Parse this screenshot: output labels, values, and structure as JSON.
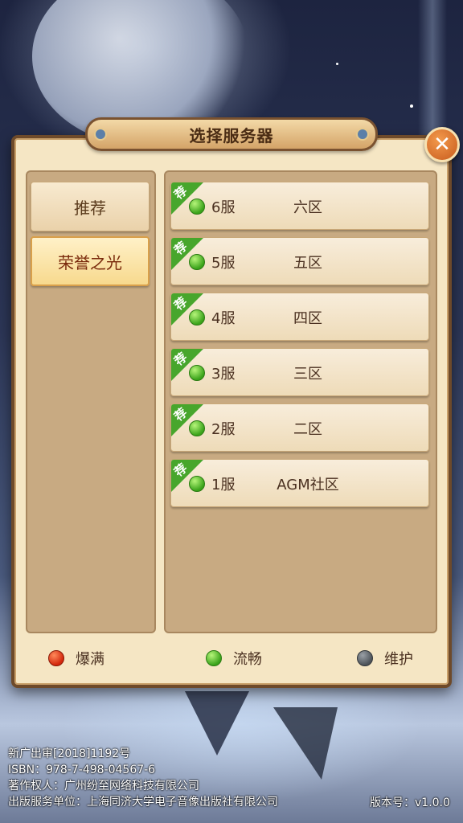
{
  "dialog": {
    "title": "选择服务器",
    "close_label": "✕"
  },
  "categories": [
    {
      "label": "推荐",
      "active": false
    },
    {
      "label": "荣誉之光",
      "active": true
    }
  ],
  "servers": [
    {
      "tag": "荐",
      "name": "6服",
      "area": "六区",
      "status": "流畅"
    },
    {
      "tag": "荐",
      "name": "5服",
      "area": "五区",
      "status": "流畅"
    },
    {
      "tag": "荐",
      "name": "4服",
      "area": "四区",
      "status": "流畅"
    },
    {
      "tag": "荐",
      "name": "3服",
      "area": "三区",
      "status": "流畅"
    },
    {
      "tag": "荐",
      "name": "2服",
      "area": "二区",
      "status": "流畅"
    },
    {
      "tag": "荐",
      "name": "1服",
      "area": "AGM社区",
      "status": "流畅"
    }
  ],
  "legend": [
    {
      "label": "爆满",
      "color": "#d2260c"
    },
    {
      "label": "流畅",
      "color": "#3aa31a"
    },
    {
      "label": "维护",
      "color": "#4d5359"
    }
  ],
  "footer": {
    "line1": "新广出审[2018]1192号",
    "line2": "ISBN：978-7-498-04567-6",
    "line3": "著作权人：广州纷至网络科技有限公司",
    "line4": "出版服务单位：上海同济大学电子音像出版社有限公司",
    "version": "版本号：v1.0.0"
  }
}
